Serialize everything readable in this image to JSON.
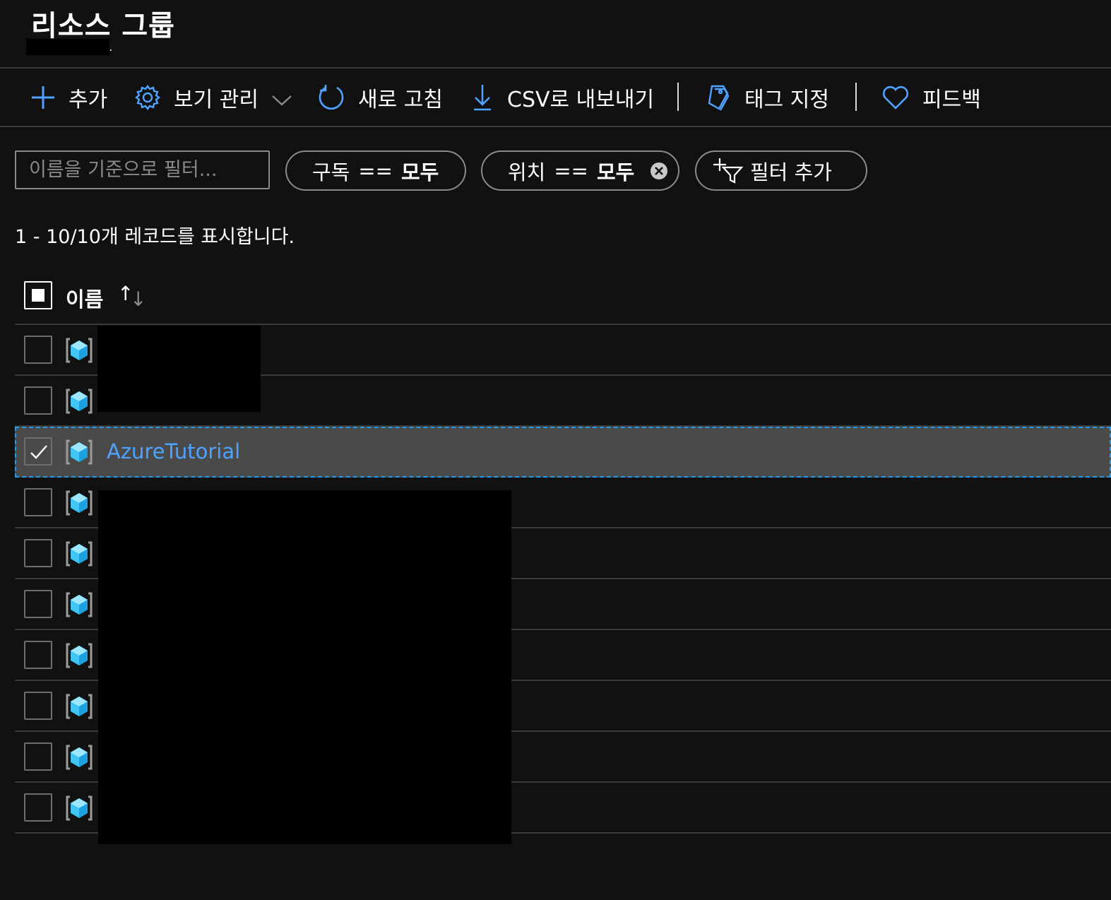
{
  "header": {
    "title": "리소스 그룹",
    "subtitle_suffix": "."
  },
  "toolbar": {
    "add_label": "추가",
    "manage_view_label": "보기 관리",
    "refresh_label": "새로 고침",
    "export_csv_label": "CSV로 내보내기",
    "assign_tags_label": "태그 지정",
    "feedback_label": "피드백"
  },
  "filters": {
    "name_placeholder": "이름을 기준으로 필터...",
    "subscription": {
      "label": "구독",
      "operator": "==",
      "value": "모두"
    },
    "location": {
      "label": "위치",
      "operator": "==",
      "value": "모두"
    },
    "add_filter_label": "필터 추가"
  },
  "records": {
    "summary": "1 - 10/10개 레코드를 표시합니다."
  },
  "table": {
    "column_name": "이름",
    "sort_up": "↑",
    "sort_down": "↓",
    "rows": [
      {
        "name": "",
        "selected": false
      },
      {
        "name": "",
        "selected": false
      },
      {
        "name": "AzureTutorial",
        "selected": true
      },
      {
        "name": "",
        "selected": false
      },
      {
        "name": "",
        "selected": false
      },
      {
        "name": "",
        "selected": false
      },
      {
        "name": "",
        "selected": false
      },
      {
        "name": "",
        "selected": false
      },
      {
        "name": "",
        "selected": false
      },
      {
        "name": "",
        "selected": false
      }
    ]
  },
  "colors": {
    "background": "#111111",
    "accent": "#4da3ff",
    "selected_row": "#4a4a4a",
    "focus_border": "#1f9cf0",
    "divider": "#3b3b3b"
  },
  "icons": {
    "add": "plus-icon",
    "manage_view": "gear-icon",
    "refresh": "refresh-icon",
    "export": "download-icon",
    "tags": "tag-icon",
    "feedback": "heart-icon",
    "clear_filter": "close-circle-icon",
    "add_filter": "add-filter-icon",
    "resource_group": "resource-group-icon"
  }
}
